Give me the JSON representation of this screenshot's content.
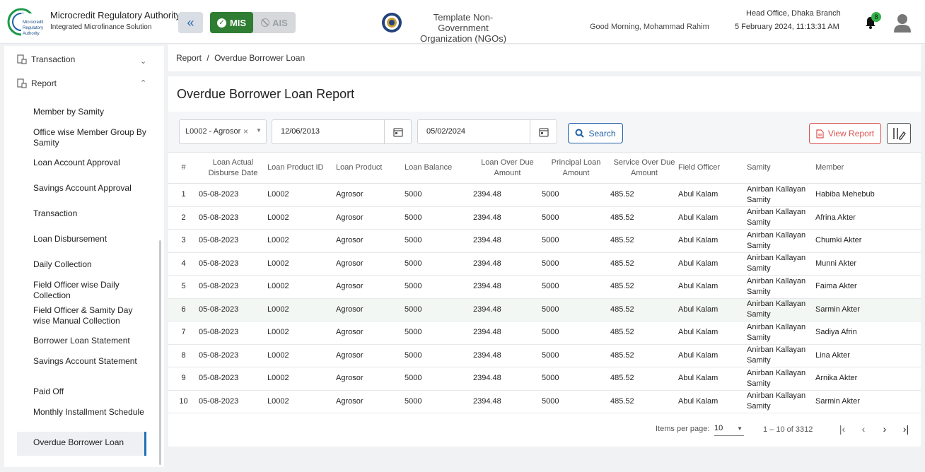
{
  "header": {
    "org_title": "Microcredit Regulatory Authority",
    "org_subtitle": "Integrated Microfinance Solution",
    "logo_text": [
      "Microcredit",
      "Regulatory",
      "Authority"
    ],
    "mode_mis": "MIS",
    "mode_ais": "AIS",
    "ngo_line1": "Template Non-Government",
    "ngo_line2": "Organization (NGOs)",
    "greeting": "Good Morning, Mohammad Rahim",
    "branch": "Head Office, Dhaka Branch",
    "datetime": "5 February 2024, 11:13:31 AM",
    "notification_count": "8"
  },
  "sidebar": {
    "groups": [
      {
        "label": "Transaction",
        "expanded": false
      },
      {
        "label": "Report",
        "expanded": true
      }
    ],
    "items": [
      "Member by Samity",
      "Office wise Member Group By Samity",
      "Loan Account Approval",
      "Savings Account Approval",
      "Transaction",
      "Loan Disbursement",
      "Daily Collection",
      "Field Officer wise Daily Collection",
      "Field Officer & Samity Day wise Manual Collection",
      "Borrower Loan Statement",
      "Savings Account Statement",
      "Paid Off",
      "Monthly Installment Schedule",
      "Overdue Borrower Loan"
    ],
    "active_item": "Overdue Borrower Loan"
  },
  "breadcrumb": [
    "Report",
    "/",
    "Overdue Borrower Loan"
  ],
  "page_title": "Overdue Borrower Loan Report",
  "filters": {
    "product": "L0002 - Agrosor",
    "from_date": "12/06/2013",
    "to_date": "05/02/2024",
    "search_label": "Search",
    "view_report_label": "View Report"
  },
  "table": {
    "columns": [
      "#",
      "Loan Actual Disburse Date",
      "Loan Product ID",
      "Loan Product",
      "Loan Balance",
      "Loan Over Due Amount",
      "Principal Loan Amount",
      "Service Over Due Amount",
      "Field Officer",
      "Samity",
      "Member"
    ],
    "rows": [
      [
        "1",
        "05-08-2023",
        "L0002",
        "Agrosor",
        "5000",
        "2394.48",
        "5000",
        "485.52",
        "Abul Kalam",
        "Anirban Kallayan Samity",
        "Habiba Mehebub"
      ],
      [
        "2",
        "05-08-2023",
        "L0002",
        "Agrosor",
        "5000",
        "2394.48",
        "5000",
        "485.52",
        "Abul Kalam",
        "Anirban Kallayan Samity",
        "Afrina Akter"
      ],
      [
        "3",
        "05-08-2023",
        "L0002",
        "Agrosor",
        "5000",
        "2394.48",
        "5000",
        "485.52",
        "Abul Kalam",
        "Anirban Kallayan Samity",
        "Chumki Akter"
      ],
      [
        "4",
        "05-08-2023",
        "L0002",
        "Agrosor",
        "5000",
        "2394.48",
        "5000",
        "485.52",
        "Abul Kalam",
        "Anirban Kallayan Samity",
        "Munni Akter"
      ],
      [
        "5",
        "05-08-2023",
        "L0002",
        "Agrosor",
        "5000",
        "2394.48",
        "5000",
        "485.52",
        "Abul Kalam",
        "Anirban Kallayan Samity",
        "Faima Akter"
      ],
      [
        "6",
        "05-08-2023",
        "L0002",
        "Agrosor",
        "5000",
        "2394.48",
        "5000",
        "485.52",
        "Abul Kalam",
        "Anirban Kallayan Samity",
        "Sarmin Akter"
      ],
      [
        "7",
        "05-08-2023",
        "L0002",
        "Agrosor",
        "5000",
        "2394.48",
        "5000",
        "485.52",
        "Abul Kalam",
        "Anirban Kallayan Samity",
        "Sadiya Afrin"
      ],
      [
        "8",
        "05-08-2023",
        "L0002",
        "Agrosor",
        "5000",
        "2394.48",
        "5000",
        "485.52",
        "Abul Kalam",
        "Anirban Kallayan Samity",
        "Lina Akter"
      ],
      [
        "9",
        "05-08-2023",
        "L0002",
        "Agrosor",
        "5000",
        "2394.48",
        "5000",
        "485.52",
        "Abul Kalam",
        "Anirban Kallayan Samity",
        "Arnika Akter"
      ],
      [
        "10",
        "05-08-2023",
        "L0002",
        "Agrosor",
        "5000",
        "2394.48",
        "5000",
        "485.52",
        "Abul Kalam",
        "Anirban Kallayan Samity",
        "Sarmin Akter"
      ]
    ]
  },
  "pager": {
    "label": "Items per page:",
    "page_size": "10",
    "range": "1 – 10 of 3312"
  },
  "colors": {
    "brand_green": "#2e7d32",
    "accent_blue": "#1f5fa8",
    "danger_red": "#d9534f"
  }
}
